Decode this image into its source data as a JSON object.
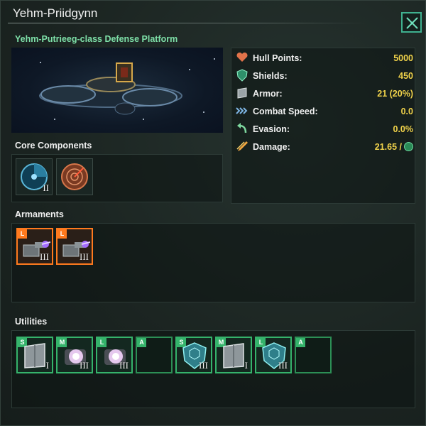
{
  "window": {
    "title": "Yehm-Priidgynn",
    "subtitle": "Yehm-Putrieeg-class Defense Platform",
    "close_icon": "close-x-icon",
    "accent_color": "#3fb08f"
  },
  "stats": [
    {
      "label": "Hull Points:",
      "value": "5000",
      "icon": "heart-icon"
    },
    {
      "label": "Shields:",
      "value": "450",
      "icon": "shield-icon"
    },
    {
      "label": "Armor:",
      "value": "21 (20%)",
      "icon": "armor-plate-icon"
    },
    {
      "label": "Combat Speed:",
      "value": "0.0",
      "icon": "speed-chevrons-icon"
    },
    {
      "label": "Evasion:",
      "value": "0.0%",
      "icon": "evasion-arrow-icon"
    },
    {
      "label": "Damage:",
      "value": "21.65 /",
      "icon": "damage-bolt-icon",
      "suffix_icon": "day-clock-icon"
    }
  ],
  "core_components": {
    "label": "Core Components",
    "slots": [
      {
        "name": "combat-computer-icon",
        "tier": "II"
      },
      {
        "name": "sensor-radar-icon",
        "tier": ""
      }
    ]
  },
  "armaments": {
    "label": "Armaments",
    "slots": [
      {
        "badge": "L",
        "name": "laser-weapon-icon",
        "tier": "III"
      },
      {
        "badge": "L",
        "name": "laser-weapon-icon",
        "tier": "III"
      }
    ]
  },
  "utilities": {
    "label": "Utilities",
    "slots": [
      {
        "badge": "S",
        "name": "armor-plate-icon",
        "tier": "I",
        "kind": "armor"
      },
      {
        "badge": "M",
        "name": "shield-generator-icon",
        "tier": "III",
        "kind": "shieldgen"
      },
      {
        "badge": "L",
        "name": "shield-generator-icon",
        "tier": "III",
        "kind": "shieldgen"
      },
      {
        "badge": "A",
        "name": "empty-slot",
        "tier": "",
        "kind": "empty"
      },
      {
        "badge": "S",
        "name": "hex-shield-icon",
        "tier": "III",
        "kind": "hex"
      },
      {
        "badge": "M",
        "name": "armor-plate-icon",
        "tier": "I",
        "kind": "armor"
      },
      {
        "badge": "L",
        "name": "hex-shield-icon",
        "tier": "III",
        "kind": "hex"
      },
      {
        "badge": "A",
        "name": "empty-slot",
        "tier": "",
        "kind": "empty"
      }
    ]
  }
}
